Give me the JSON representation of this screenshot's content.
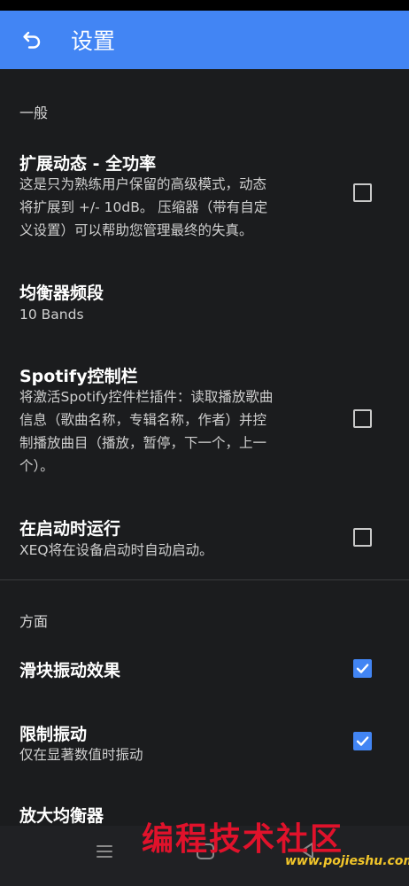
{
  "app": {
    "title": "设置"
  },
  "sections": {
    "general": "一般",
    "aspect": "方面"
  },
  "items": [
    {
      "title": "扩展动态 - 全功率",
      "summary": [
        "这是只为熟练用户保留的高级模式，动态",
        "将扩展到 +/- 10dB。 压缩器（带有自定",
        "义设置）可以帮助您管理最终的失真。"
      ],
      "checked": false
    },
    {
      "title": "均衡器频段",
      "summary": [
        "10 Bands"
      ]
    },
    {
      "title": "Spotify控制栏",
      "summary": [
        "将激活Spotify控件栏插件：读取播放歌曲",
        "信息（歌曲名称，专辑名称，作者）并控",
        "制播放曲目（播放，暂停，下一个，上一",
        "个）。"
      ],
      "checked": false
    },
    {
      "title": "在启动时运行",
      "summary": [
        "XEQ将在设备启动时自动启动。"
      ],
      "checked": false
    },
    {
      "title": "滑块振动效果",
      "summary": [],
      "checked": true
    },
    {
      "title": "限制振动",
      "summary": [
        "仅在显著数值时振动"
      ],
      "checked": true
    },
    {
      "title": "放大均衡器",
      "summary": []
    }
  ],
  "watermark": {
    "text": "编程技术社区",
    "url": "www.pojieshu.com"
  },
  "colors": {
    "accent": "#4285f4",
    "background": "#1b1c1e",
    "watermark": "#e0122b"
  },
  "icons": {
    "back": "back-arrow-icon",
    "menu": "menu-icon",
    "home": "home-icon",
    "back_nav": "triangle-back-icon"
  }
}
